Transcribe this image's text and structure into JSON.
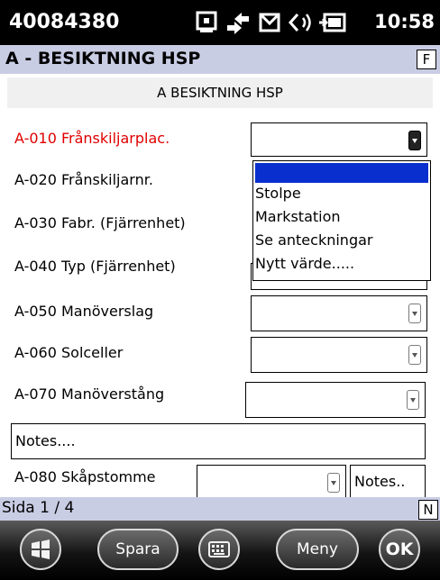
{
  "status_bar": {
    "title": "40084380",
    "time": "10:58",
    "icons": [
      "sync-icon",
      "connection-icon",
      "message-icon",
      "volume-icon",
      "battery-icon"
    ]
  },
  "header": {
    "title": "A - BESIKTNING HSP",
    "letter": "F"
  },
  "section": {
    "title": "A BESIKTNING HSP"
  },
  "fields": [
    {
      "label": "A-010 Frånskiljarplac."
    },
    {
      "label": "A-020 Frånskiljarnr."
    },
    {
      "label": "A-030 Fabr. (Fjärrenhet)"
    },
    {
      "label": "A-040 Typ (Fjärrenhet)"
    },
    {
      "label": "A-050 Manöverslag"
    },
    {
      "label": "A-060 Solceller"
    },
    {
      "label": "A-070 Manöverstång"
    },
    {
      "label": "A-080 Skåpstomme"
    }
  ],
  "notes": {
    "wide": "Notes....",
    "small": "Notes.."
  },
  "dropdown": {
    "options": [
      "",
      "Stolpe",
      "Markstation",
      "Se anteckningar",
      "Nytt värde....."
    ]
  },
  "footer": {
    "page": "Sida 1 / 4",
    "letter": "N"
  },
  "softkeys": {
    "save": "Spara",
    "menu": "Meny",
    "ok": "OK"
  },
  "colors": {
    "active_label": "#e00000",
    "selection": "#0a2fcf",
    "header_bg": "#c9cde4"
  }
}
